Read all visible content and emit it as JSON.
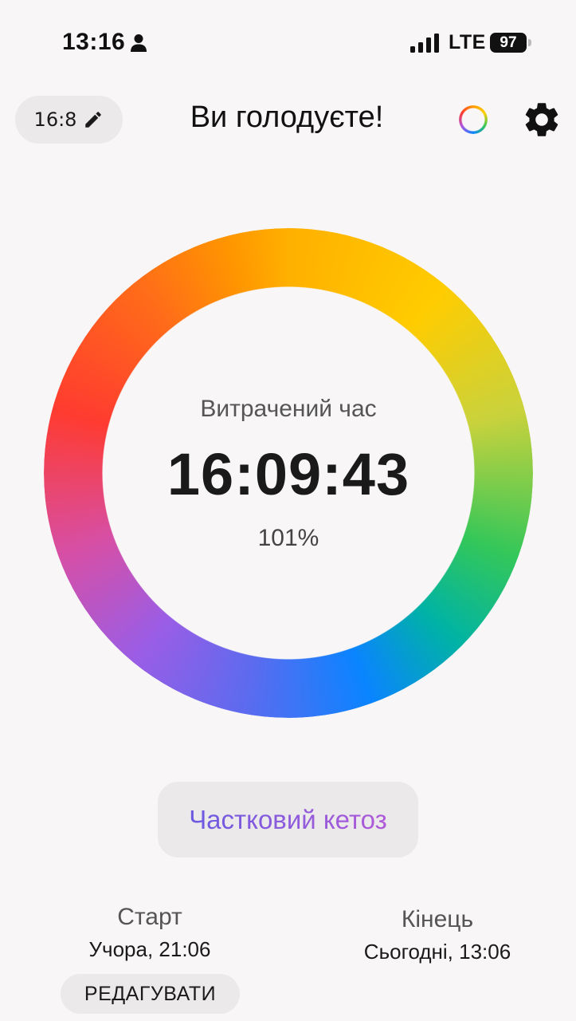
{
  "status_bar": {
    "time": "13:16",
    "network": "LTE",
    "battery": "97"
  },
  "header": {
    "plan_label": "16:8",
    "title": "Ви голодуєте!"
  },
  "timer": {
    "label": "Витрачений час",
    "elapsed": "16:09:43",
    "percent": "101%"
  },
  "status": {
    "ketosis_label": "Частковий кетоз"
  },
  "start": {
    "title": "Старт",
    "value": "Учора, 21:06",
    "edit_label": "РЕДАГУВАТИ"
  },
  "end": {
    "title": "Кінець",
    "value": "Сьогодні, 13:06"
  },
  "icons": {
    "person": "person-icon",
    "signal": "signal-icon",
    "pencil": "pencil-icon",
    "ring": "progress-ring-icon",
    "settings": "gear-icon"
  }
}
